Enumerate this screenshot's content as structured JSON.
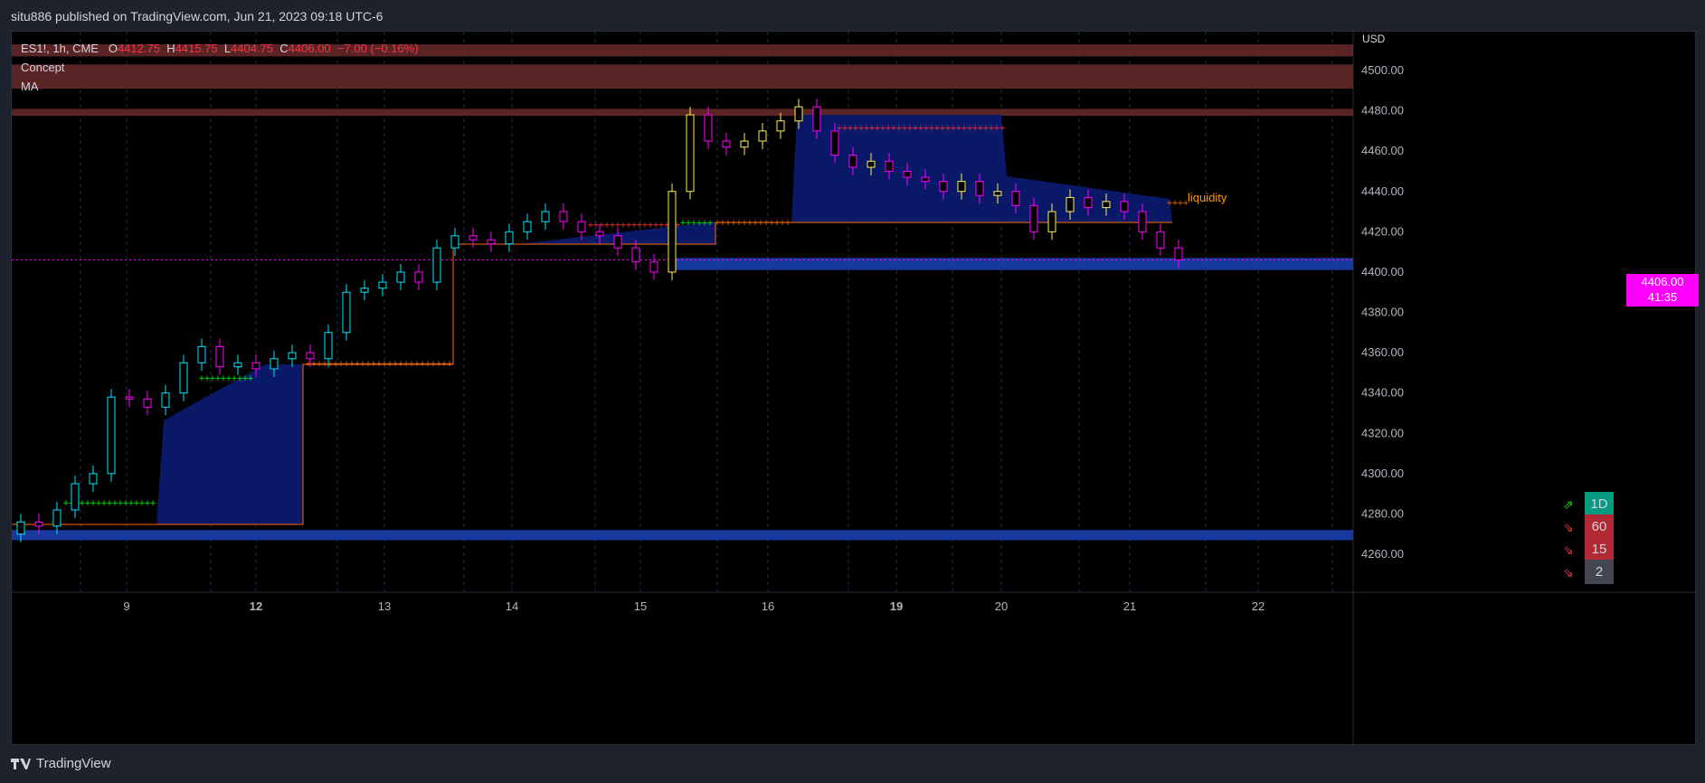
{
  "header": {
    "published_by": "situ886 published on TradingView.com, Jun 21, 2023 09:18 UTC-6"
  },
  "legend": {
    "symbol": "ES1!, 1h, CME",
    "open_label": "O",
    "open": "4412.75",
    "high_label": "H",
    "high": "4415.75",
    "low_label": "L",
    "low": "4404.75",
    "close_label": "C",
    "close": "4406.00",
    "change": "−7.00 (−0.16%)",
    "indicators": [
      "Concept",
      "MA"
    ]
  },
  "price_axis": {
    "currency": "USD",
    "current_price": "4406.00",
    "countdown": "41:35"
  },
  "annotations": {
    "liquidity": "liquidity"
  },
  "timeframes": [
    {
      "label": "1D",
      "direction": "up",
      "color": "#089981"
    },
    {
      "label": "60",
      "direction": "down",
      "color": "#b22833"
    },
    {
      "label": "15",
      "direction": "down",
      "color": "#b22833"
    },
    {
      "label": "2",
      "direction": "down",
      "color": "#434651"
    }
  ],
  "footer": {
    "brand": "TradingView"
  },
  "chart_data": {
    "type": "candlestick",
    "y_ticks": [
      4260,
      4280,
      4300,
      4320,
      4340,
      4360,
      4380,
      4400,
      4420,
      4440,
      4460,
      4480,
      4500
    ],
    "ylim": [
      4250,
      4520
    ],
    "x_ticks": [
      "9",
      "12",
      "13",
      "14",
      "15",
      "16",
      "19",
      "20",
      "21",
      "22"
    ],
    "last_price": 4406.0,
    "supply_zones": [
      {
        "low": 4507,
        "high": 4513
      },
      {
        "low": 4491,
        "high": 4503
      },
      {
        "low": 4477.5,
        "high": 4481
      }
    ],
    "demand_zones": [
      {
        "low": 4401,
        "high": 4407
      },
      {
        "low": 4267,
        "high": 4272
      }
    ],
    "trend_levels": [
      {
        "from_day": "8",
        "to_day": "9",
        "value": 4286,
        "color": "#00ff00"
      },
      {
        "from_day": "9",
        "to_day": "12",
        "value": 4348,
        "color": "#00ff00"
      },
      {
        "from_day": "12",
        "to_day": "13",
        "value": 4355,
        "color": "#ff6a00"
      },
      {
        "from_day": "14",
        "to_day": "15",
        "value": 4424,
        "color": "#ff3333"
      },
      {
        "from_day": "15",
        "to_day": "16",
        "value": 4425,
        "color": "#00ff00"
      },
      {
        "from_day": "15",
        "to_day": "16",
        "value": 4425,
        "color": "#ff6a00"
      },
      {
        "from_day": "16",
        "to_day": "20",
        "value": 4472,
        "color": "#ff3333"
      },
      {
        "from_day": "20",
        "to_day": "21",
        "value": 4435,
        "color": "#ff3333"
      }
    ],
    "candles_close": [
      4276,
      4274,
      4282,
      4295,
      4300,
      4338,
      4337,
      4333,
      4340,
      4355,
      4363,
      4353,
      4355,
      4352,
      4357,
      4360,
      4357,
      4370,
      4390,
      4392,
      4395,
      4400,
      4395,
      4412,
      4418,
      4416,
      4414,
      4420,
      4425,
      4430,
      4425,
      4420,
      4418,
      4412,
      4405,
      4400,
      4440,
      4478,
      4465,
      4462,
      4465,
      4470,
      4475,
      4482,
      4470,
      4458,
      4452,
      4455,
      4450,
      4447,
      4445,
      4440,
      4445,
      4438,
      4440,
      4433,
      4420,
      4430,
      4437,
      4432,
      4435,
      4430,
      4420,
      4412,
      4406
    ]
  }
}
